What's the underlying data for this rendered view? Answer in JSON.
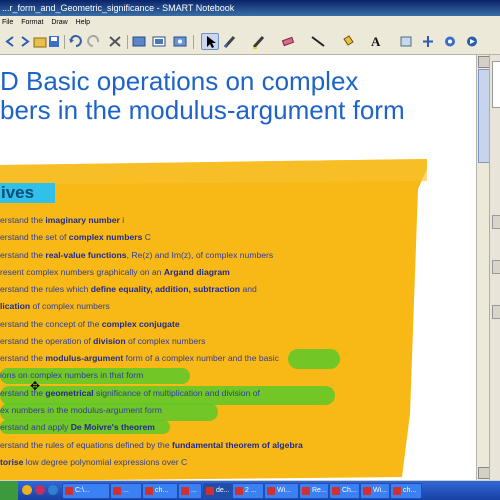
{
  "window": {
    "title": "...r_form_and_Geometric_significance - SMART Notebook"
  },
  "menu": [
    "File",
    "Format",
    "Draw",
    "Help"
  ],
  "toolbar": {
    "icons": [
      "undo-icon",
      "redo-icon",
      "delete-icon",
      "screen-shade-icon",
      "full-screen-icon",
      "capture-icon",
      "select-icon",
      "pen-icon",
      "highlighter-icon",
      "eraser-icon",
      "line-icon",
      "fill-icon",
      "text-icon",
      "properties-icon",
      "move-toolbar-icon",
      "more-icon"
    ]
  },
  "page": {
    "title_line1": "D Basic operations on complex",
    "title_line2": "bers in the modulus-argument form",
    "objectives_label": "ives"
  },
  "objectives": [
    {
      "pre": "erstand the ",
      "bold": "imaginary number",
      "post": " i"
    },
    {
      "pre": "erstand the set of ",
      "bold": "complex numbers",
      "post": " C"
    },
    {
      "pre": "erstand the ",
      "bold": "real-value functions",
      "post": ", Re(z) and Im(z), of complex numbers"
    },
    {
      "pre": "resent complex numbers graphically on an ",
      "bold": "Argand diagram",
      "post": ""
    },
    {
      "pre": "erstand the rules which ",
      "bold": "define equality, addition, subtraction",
      "post": " and"
    },
    {
      "pre": "",
      "bold": "lication",
      "post": " of complex numbers"
    },
    {
      "pre": "erstand the concept of the ",
      "bold": "complex conjugate",
      "post": ""
    },
    {
      "pre": "erstand the operation of ",
      "bold": "division",
      "post": " of complex numbers"
    },
    {
      "pre": "erstand the ",
      "bold": "modulus-argument",
      "post": " form of a complex number and the basic"
    },
    {
      "pre": "ions on complex numbers in that form",
      "bold": "",
      "post": ""
    },
    {
      "pre": "erstand the ",
      "bold": "geometrical",
      "post": " significance of multiplication and division of"
    },
    {
      "pre": "ex numbers in the modulus-argument form",
      "bold": "",
      "post": ""
    },
    {
      "pre": "erstand and apply ",
      "bold": "De Moivre's theorem",
      "post": ""
    },
    {
      "pre": "erstand the rules of equations defined by the ",
      "bold": "fundamental theorem of algebra",
      "post": ""
    },
    {
      "pre": "",
      "bold": "torise",
      "post": " low degree polynomial expressions over C"
    }
  ],
  "taskbar": {
    "buttons": [
      "C:\\...",
      "...",
      "ch...",
      "...",
      "de...",
      "2 ...",
      "Wi...",
      "Re...",
      "Ch...",
      "Wi...",
      "ch..."
    ]
  },
  "colors": {
    "title": "#1e64c8",
    "objectives_panel": "#f8b816",
    "label_bg": "#30c0e8",
    "highlight": "#5ac828",
    "objective_text": "#2f3f9a"
  }
}
